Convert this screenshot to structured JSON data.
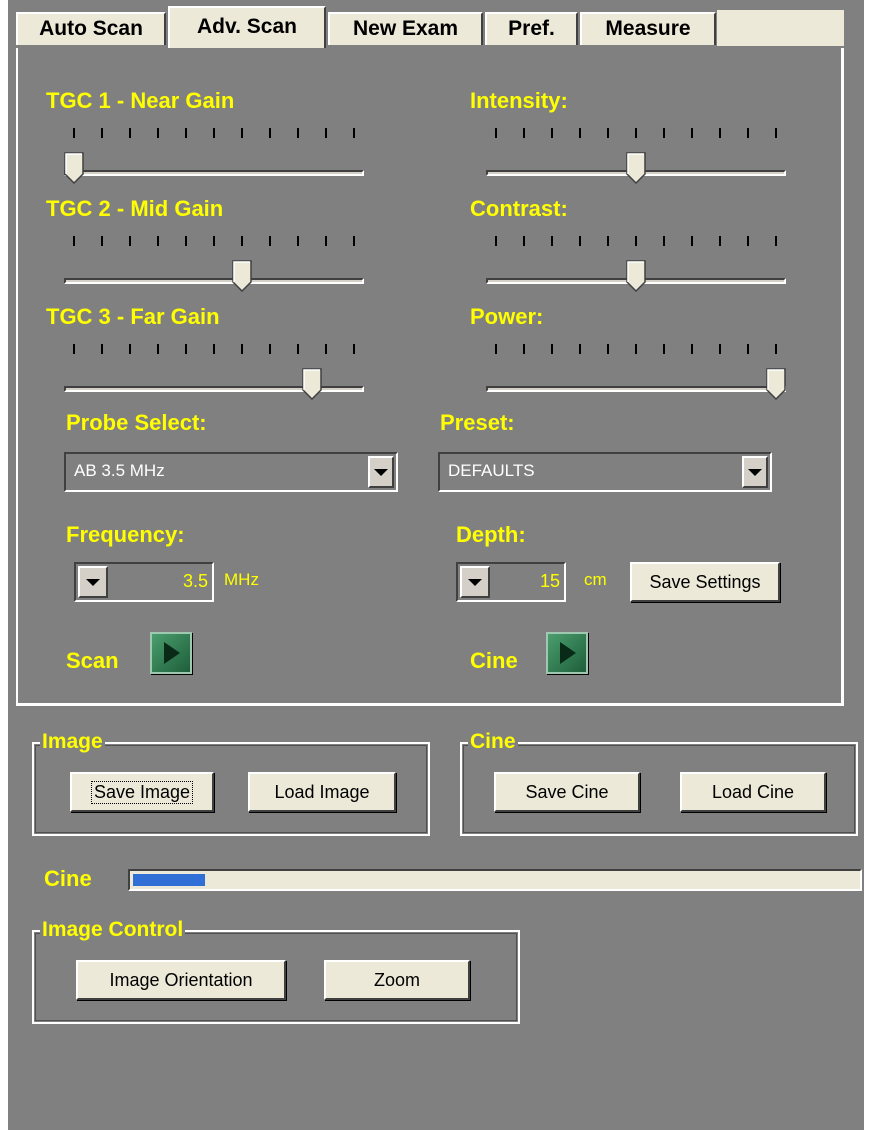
{
  "tabs": [
    {
      "label": "Auto Scan",
      "active": false
    },
    {
      "label": "Adv. Scan",
      "active": true
    },
    {
      "label": "New Exam",
      "active": false
    },
    {
      "label": "Pref.",
      "active": false
    },
    {
      "label": "Measure",
      "active": false
    }
  ],
  "sliders": {
    "tgc1": {
      "label": "TGC 1 - Near Gain",
      "value": 0.0
    },
    "tgc2": {
      "label": "TGC 2 - Mid Gain",
      "value": 0.6
    },
    "tgc3": {
      "label": "TGC 3 - Far Gain",
      "value": 0.85
    },
    "intensity": {
      "label": "Intensity:",
      "value": 0.5
    },
    "contrast": {
      "label": "Contrast:",
      "value": 0.5
    },
    "power": {
      "label": "Power:",
      "value": 1.0
    }
  },
  "probe": {
    "label": "Probe Select:",
    "value": "AB 3.5 MHz"
  },
  "preset": {
    "label": "Preset:",
    "value": "DEFAULTS"
  },
  "frequency": {
    "label": "Frequency:",
    "value": "3.5",
    "unit": "MHz"
  },
  "depth": {
    "label": "Depth:",
    "value": "15",
    "unit": "cm"
  },
  "save_settings": "Save Settings",
  "scan_label": "Scan",
  "cine_label": "Cine",
  "image_group": {
    "title": "Image",
    "save": "Save Image",
    "load": "Load Image"
  },
  "cine_group": {
    "title": "Cine",
    "save": "Save Cine",
    "load": "Load Cine"
  },
  "cine_progress": {
    "label": "Cine",
    "fraction": 0.1
  },
  "image_control": {
    "title": "Image Control",
    "orientation": "Image Orientation",
    "zoom": "Zoom"
  },
  "colors": {
    "label_yellow": "#ffff00",
    "background": "#808080",
    "button_face": "#ece9d8",
    "progress_fill": "#2f6fd6"
  }
}
